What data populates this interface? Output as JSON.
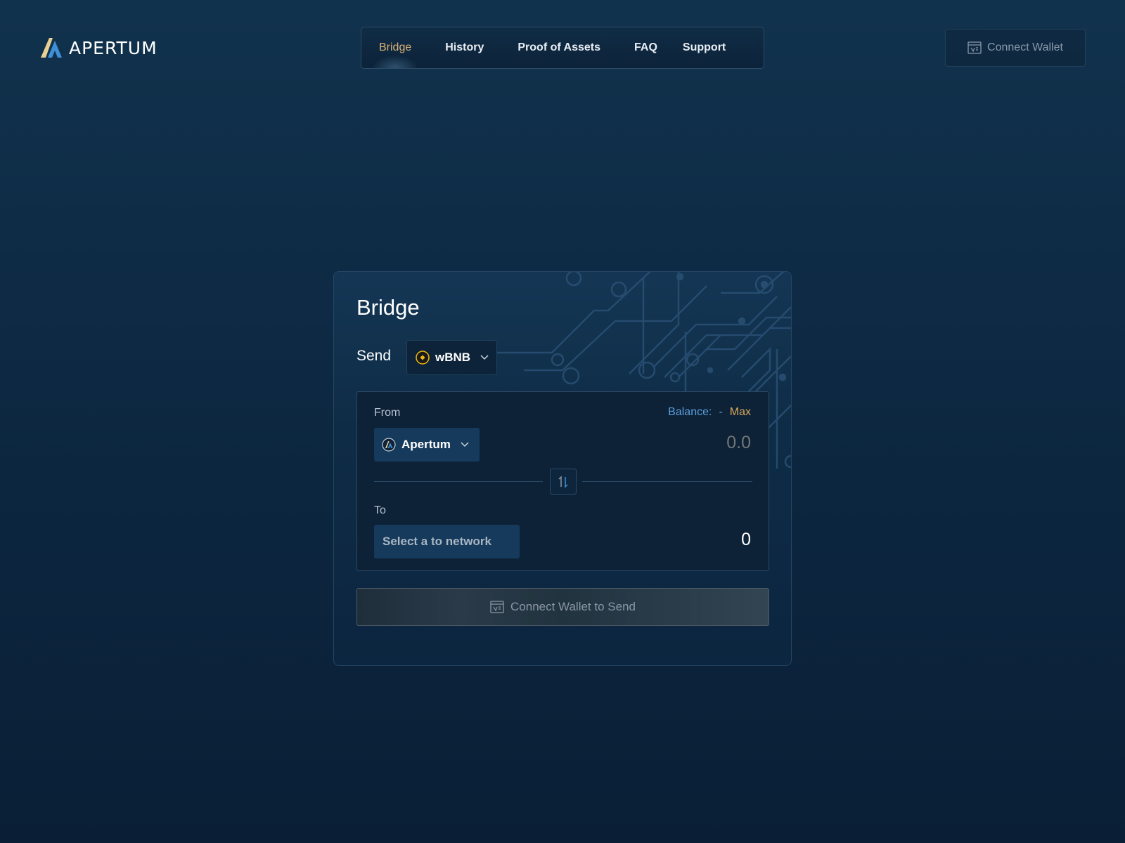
{
  "brand": {
    "name": "APERTUM"
  },
  "nav": {
    "items": [
      {
        "label": "Bridge",
        "active": true
      },
      {
        "label": "History"
      },
      {
        "label": "Proof of Assets"
      },
      {
        "label": "FAQ"
      },
      {
        "label": "Support"
      }
    ]
  },
  "header": {
    "connect_label": "Connect Wallet"
  },
  "bridge": {
    "title": "Bridge",
    "send_label": "Send",
    "token": {
      "symbol": "wBNB",
      "icon": "bnb-token-icon",
      "color": "#f0b90b"
    },
    "from": {
      "label": "From",
      "balance_label": "Balance:",
      "balance_value": "-",
      "max_label": "Max",
      "network": "Apertum",
      "amount_placeholder": "0.0"
    },
    "to": {
      "label": "To",
      "network_placeholder": "Select a to network",
      "amount": "0"
    },
    "submit_label": "Connect Wallet to Send"
  },
  "colors": {
    "accent_gold": "#d9b27a",
    "balance_blue": "#5b9fdc",
    "background": "#0d2842"
  }
}
